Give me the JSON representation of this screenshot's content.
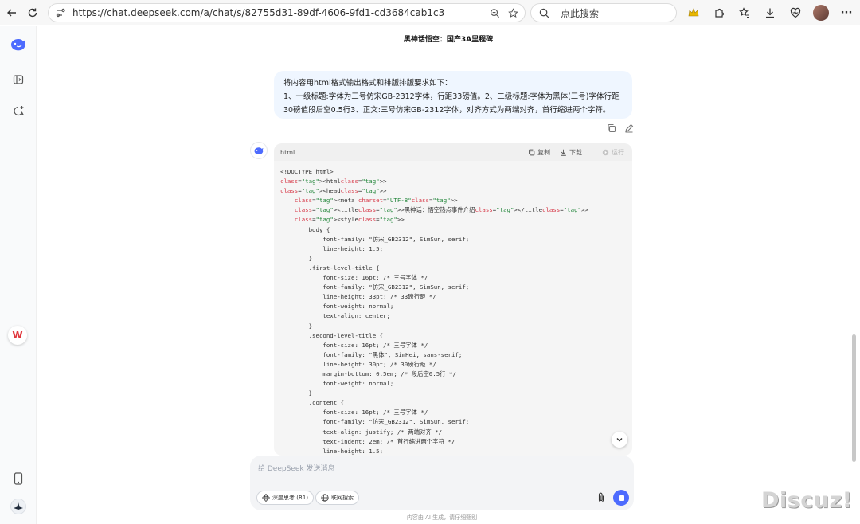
{
  "browser": {
    "url": "https://chat.deepseek.com/a/chat/s/82755d31-89df-4606-9fd1-cd3684cab1c3",
    "search_placeholder": "点此搜索"
  },
  "sidebar": {
    "logo_icon": "deepseek-whale-icon",
    "items": [
      "sidebar-toggle-icon",
      "new-chat-icon"
    ],
    "bottom_items": [
      "mobile-app-icon",
      "profile-avatar"
    ],
    "wps_badge": "W"
  },
  "chat": {
    "title": "黑神话悟空：国产3A里程碑",
    "user_message": {
      "line1": "将内容用html格式输出格式和排版排版要求如下：",
      "line2": "1、一级标题:字体为三号仿宋GB-2312字体，行距33磅值。2、二级标题:字体为黑体(三号)字体行距",
      "line3": "30磅值段后空0.5行3、正文:三号仿宋GB-2312字体，对齐方式为两端对齐，首行缩进两个字符。"
    },
    "code_block": {
      "language": "html",
      "copy_label": "复制",
      "download_label": "下载",
      "run_label": "运行",
      "lines": [
        "<!DOCTYPE html>",
        "<html>",
        "<head>",
        "    <meta charset=\"UTF-8\">",
        "    <title>黑神话：悟空热点事件介绍</title>",
        "    <style>",
        "        body {",
        "            font-family: \"仿宋_GB2312\", SimSun, serif;",
        "            line-height: 1.5;",
        "        }",
        "        .first-level-title {",
        "            font-size: 16pt; /* 三号字体 */",
        "            font-family: \"仿宋_GB2312\", SimSun, serif;",
        "            line-height: 33pt; /* 33磅行距 */",
        "            font-weight: normal;",
        "            text-align: center;",
        "        }",
        "        .second-level-title {",
        "            font-size: 16pt; /* 三号字体 */",
        "            font-family: \"黑体\", SimHei, sans-serif;",
        "            line-height: 30pt; /* 30磅行距 */",
        "            margin-bottom: 0.5em; /* 段后空0.5行 */",
        "            font-weight: normal;",
        "        }",
        "        .content {",
        "            font-size: 16pt; /* 三号字体 */",
        "            font-family: \"仿宋_GB2312\", SimSun, serif;",
        "            text-align: justify; /* 两端对齐 */",
        "            text-indent: 2em; /* 首行缩进两个字符 */",
        "            line-height: 1.5;"
      ]
    }
  },
  "composer": {
    "placeholder": "给 DeepSeek 发送消息",
    "deep_think_label": "深度思考 (R1)",
    "web_search_label": "联网搜索"
  },
  "footer": {
    "disclaimer": "内容由 AI 生成，请仔细甄别"
  },
  "watermark": "Discuz!",
  "colors": {
    "accent": "#4d6bfe",
    "user_bubble": "#eff6ff",
    "code_bg": "#f5f5f5",
    "tag_color": "#d73a49",
    "string_color": "#22863a"
  }
}
